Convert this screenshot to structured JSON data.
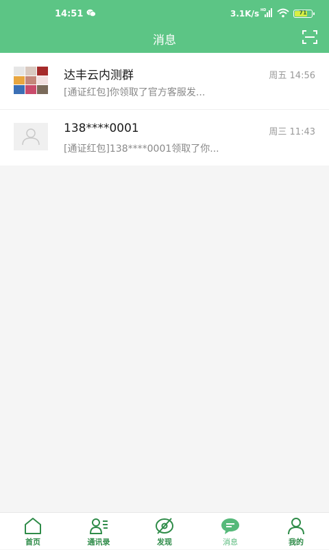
{
  "status_bar": {
    "time": "14:51",
    "network_speed": "3.1K/s",
    "battery": "71",
    "battery_level": 0.71
  },
  "header": {
    "title": "消息",
    "right_icon": "scan-icon"
  },
  "chats": [
    {
      "name": "达丰云内测群",
      "time": "周五 14:56",
      "preview": "[通证红包]你领取了官方客服发...",
      "avatar": "group-avatar"
    },
    {
      "name": "138****0001",
      "time": "周三 11:43",
      "preview": "[通证红包]138****0001领取了你...",
      "avatar": "default-user-avatar"
    }
  ],
  "tabs": [
    {
      "label": "首页",
      "icon": "home-icon"
    },
    {
      "label": "通讯录",
      "icon": "contacts-icon"
    },
    {
      "label": "发现",
      "icon": "discover-icon"
    },
    {
      "label": "消息",
      "icon": "message-icon",
      "active": true
    },
    {
      "label": "我的",
      "icon": "profile-icon"
    }
  ],
  "colors": {
    "brand_green": "#5cc585",
    "tab_green": "#2e8b48",
    "active_tab": "#56b97a",
    "background": "#f5f5f5"
  }
}
